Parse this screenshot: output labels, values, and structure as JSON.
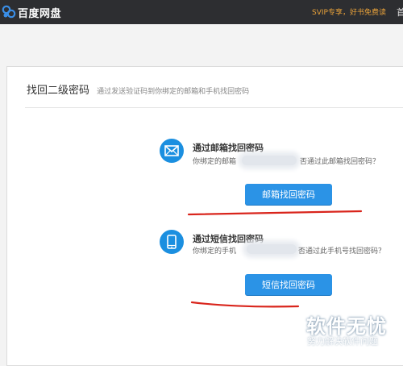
{
  "header": {
    "logo_text": "百度网盘",
    "promo_text": "SVIP专享，好书免费读",
    "right_cut_text": "首"
  },
  "panel": {
    "title": "找回二级密码",
    "subtitle": "通过发送验证码到你绑定的邮箱和手机找回密码"
  },
  "email_method": {
    "icon": "envelope-icon",
    "title": "通过邮箱找回密码",
    "desc_start": "你绑定的邮箱",
    "desc_end": "否通过此邮箱找回密码？",
    "button_label": "邮箱找回密码"
  },
  "sms_method": {
    "icon": "phone-icon",
    "title": "通过短信找回密码",
    "desc_start": "你绑定的手机",
    "desc_end": "否通过此手机号找回密码？",
    "button_label": "短信找回密码"
  },
  "watermark": {
    "title": "软件无忧",
    "subtitle": "努力解决软件问题"
  },
  "colors": {
    "topbar_bg": "#2d2e31",
    "accent_blue": "#2b93e6",
    "promo_orange": "#e8a13a",
    "annotation_red": "#d9251c"
  }
}
